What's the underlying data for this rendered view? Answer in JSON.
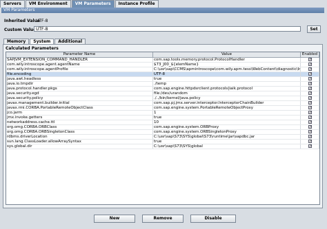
{
  "top_tabs": [
    "Servers",
    "VM Environment",
    "VM Parameters",
    "Instance Profile"
  ],
  "vm_bar_title": "VM Parameters",
  "inherited": {
    "label": "Inherited Value",
    "value": "UTF-8"
  },
  "custom": {
    "label": "Custom Value",
    "value": "UTF-8",
    "set_label": "Set"
  },
  "sub_tabs": [
    "Memory",
    "System",
    "Additional"
  ],
  "calc_title": "Calculated Parameters",
  "columns": [
    "Parameter Name",
    "Value",
    "Enabled"
  ],
  "rows": [
    {
      "name": "SAPJVM_EXTENSION_COMMAND_HANDLER",
      "value": "com.sap.tools.memory.protocol.ProtocolHandler",
      "enabled": true
    },
    {
      "name": "com.wily.introscope.agent.agentName",
      "value": "$73_J00_${elemName}",
      "enabled": true
    },
    {
      "name": "com.wily.introscope.agentProfile",
      "value": "C:\\usr\\sap\\CCMS\\apmintroscope\\com.wily.apm.tess\\WebContent\\diagnostic\\Intros...",
      "enabled": true
    },
    {
      "name": "file.encoding",
      "value": "UTF-8",
      "enabled": true
    },
    {
      "name": "java.awt.headless",
      "value": "true",
      "enabled": true
    },
    {
      "name": "java.io.tmpdir",
      "value": "./temp",
      "enabled": true
    },
    {
      "name": "java.protocol.handler.pkgs",
      "value": "com.sap.engine.httpdsrclient.protocols|iaik.protocol",
      "enabled": true
    },
    {
      "name": "java.security.egd",
      "value": "file:/dev/urandom",
      "enabled": true
    },
    {
      "name": "java.security.policy",
      "value": "./../bin/kernel/java.policy",
      "enabled": true
    },
    {
      "name": "javax.management.builder.initial",
      "value": "com.sap.pj.jmx.server.interceptor.InterceptorChainBuilder",
      "enabled": true
    },
    {
      "name": "javax.rmi.CORBA.PortableRemoteObjectClass",
      "value": "com.sap.engine.system.PortableRemoteObjectProxy",
      "enabled": true
    },
    {
      "name": "jco.jarm",
      "value": "1",
      "enabled": true
    },
    {
      "name": "jmx.invoke.getters",
      "value": "true",
      "enabled": true
    },
    {
      "name": "networkaddress.cache.ttl",
      "value": "10",
      "enabled": true
    },
    {
      "name": "org.omg.CORBA.ORBClass",
      "value": "com.sap.engine.system.ORBProxy",
      "enabled": true
    },
    {
      "name": "org.omg.CORBA.ORBSingletonClass",
      "value": "com.sap.engine.system.ORBSingletonProxy",
      "enabled": true
    },
    {
      "name": "rdbms.driverLocation",
      "value": "C:\\usr\\sap\\S73\\SYS\\global\\S73\\runtime\\jar\\sapdbc.jar",
      "enabled": true
    },
    {
      "name": "sun.lang.ClassLoader.allowArraySyntax",
      "value": "true",
      "enabled": true
    },
    {
      "name": "sys.global.dir",
      "value": "C:\\usr\\sap\\S73\\SYS\\global",
      "enabled": true
    }
  ],
  "selected_row": 3,
  "buttons": {
    "new": "New",
    "remove": "Remove",
    "disable": "Disable"
  },
  "colors": {
    "tab_active": "#6f8fb4",
    "selection": "#c8daf0",
    "background": "#d8dde3"
  }
}
